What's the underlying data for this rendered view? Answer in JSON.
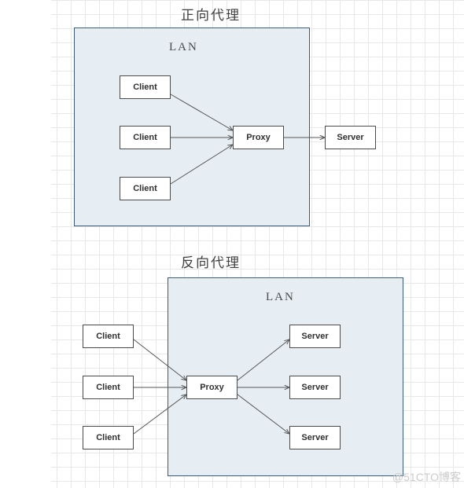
{
  "diagram1": {
    "title": "正向代理",
    "lan_label": "LAN",
    "client1": "Client",
    "client2": "Client",
    "client3": "Client",
    "proxy": "Proxy",
    "server": "Server"
  },
  "diagram2": {
    "title": "反向代理",
    "lan_label": "LAN",
    "client1": "Client",
    "client2": "Client",
    "client3": "Client",
    "proxy": "Proxy",
    "server1": "Server",
    "server2": "Server",
    "server3": "Server"
  },
  "watermark": "@51CTO博客"
}
